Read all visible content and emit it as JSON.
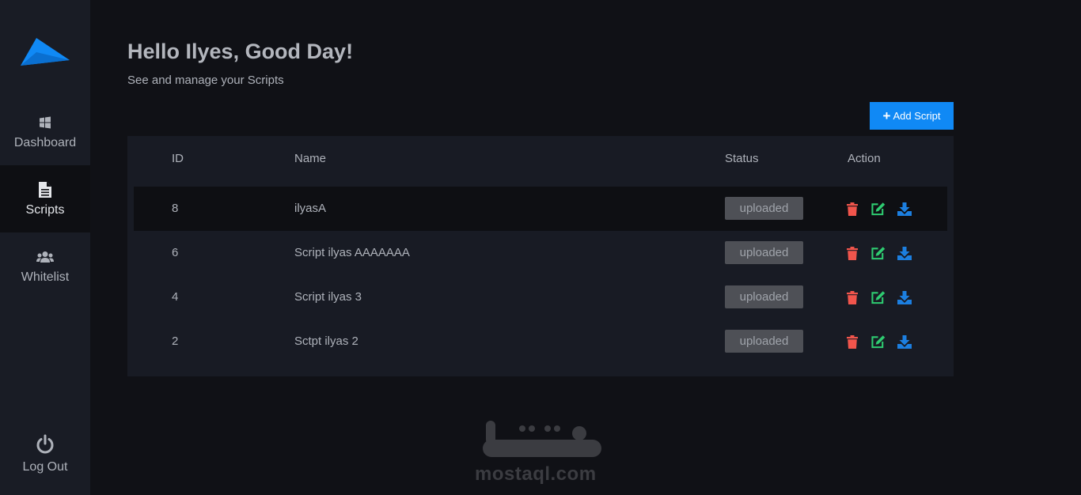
{
  "sidebar": {
    "logo": "brand-logo",
    "items": [
      {
        "label": "Dashboard",
        "icon": "windows-icon",
        "active": false
      },
      {
        "label": "Scripts",
        "icon": "file-icon",
        "active": true
      },
      {
        "label": "Whitelist",
        "icon": "users-icon",
        "active": false
      }
    ],
    "logout": {
      "label": "Log Out",
      "icon": "power-icon"
    }
  },
  "header": {
    "greeting": "Hello Ilyes, Good Day!",
    "subtitle": "See and manage your Scripts"
  },
  "toolbar": {
    "add_label": "Add Script",
    "add_icon": "plus-icon"
  },
  "table": {
    "columns": [
      "ID",
      "Name",
      "Status",
      "Action"
    ],
    "rows": [
      {
        "id": "8",
        "name": "ilyasA",
        "status": "uploaded"
      },
      {
        "id": "6",
        "name": "Script ilyas AAAAAAA",
        "status": "uploaded"
      },
      {
        "id": "4",
        "name": "Script ilyas 3",
        "status": "uploaded"
      },
      {
        "id": "2",
        "name": "Sctpt ilyas 2",
        "status": "uploaded"
      }
    ],
    "action_icons": [
      "trash-icon",
      "edit-icon",
      "download-icon"
    ]
  },
  "watermark": {
    "arabic": "مستقل",
    "latin": "mostaql.com"
  },
  "colors": {
    "background": "#101116",
    "sidebar": "#191c25",
    "panel": "#181b24",
    "accent": "#1089f5",
    "delete": "#f1554c",
    "edit": "#2ecc71",
    "download": "#1c7fe0",
    "badge": "#4e5056"
  }
}
